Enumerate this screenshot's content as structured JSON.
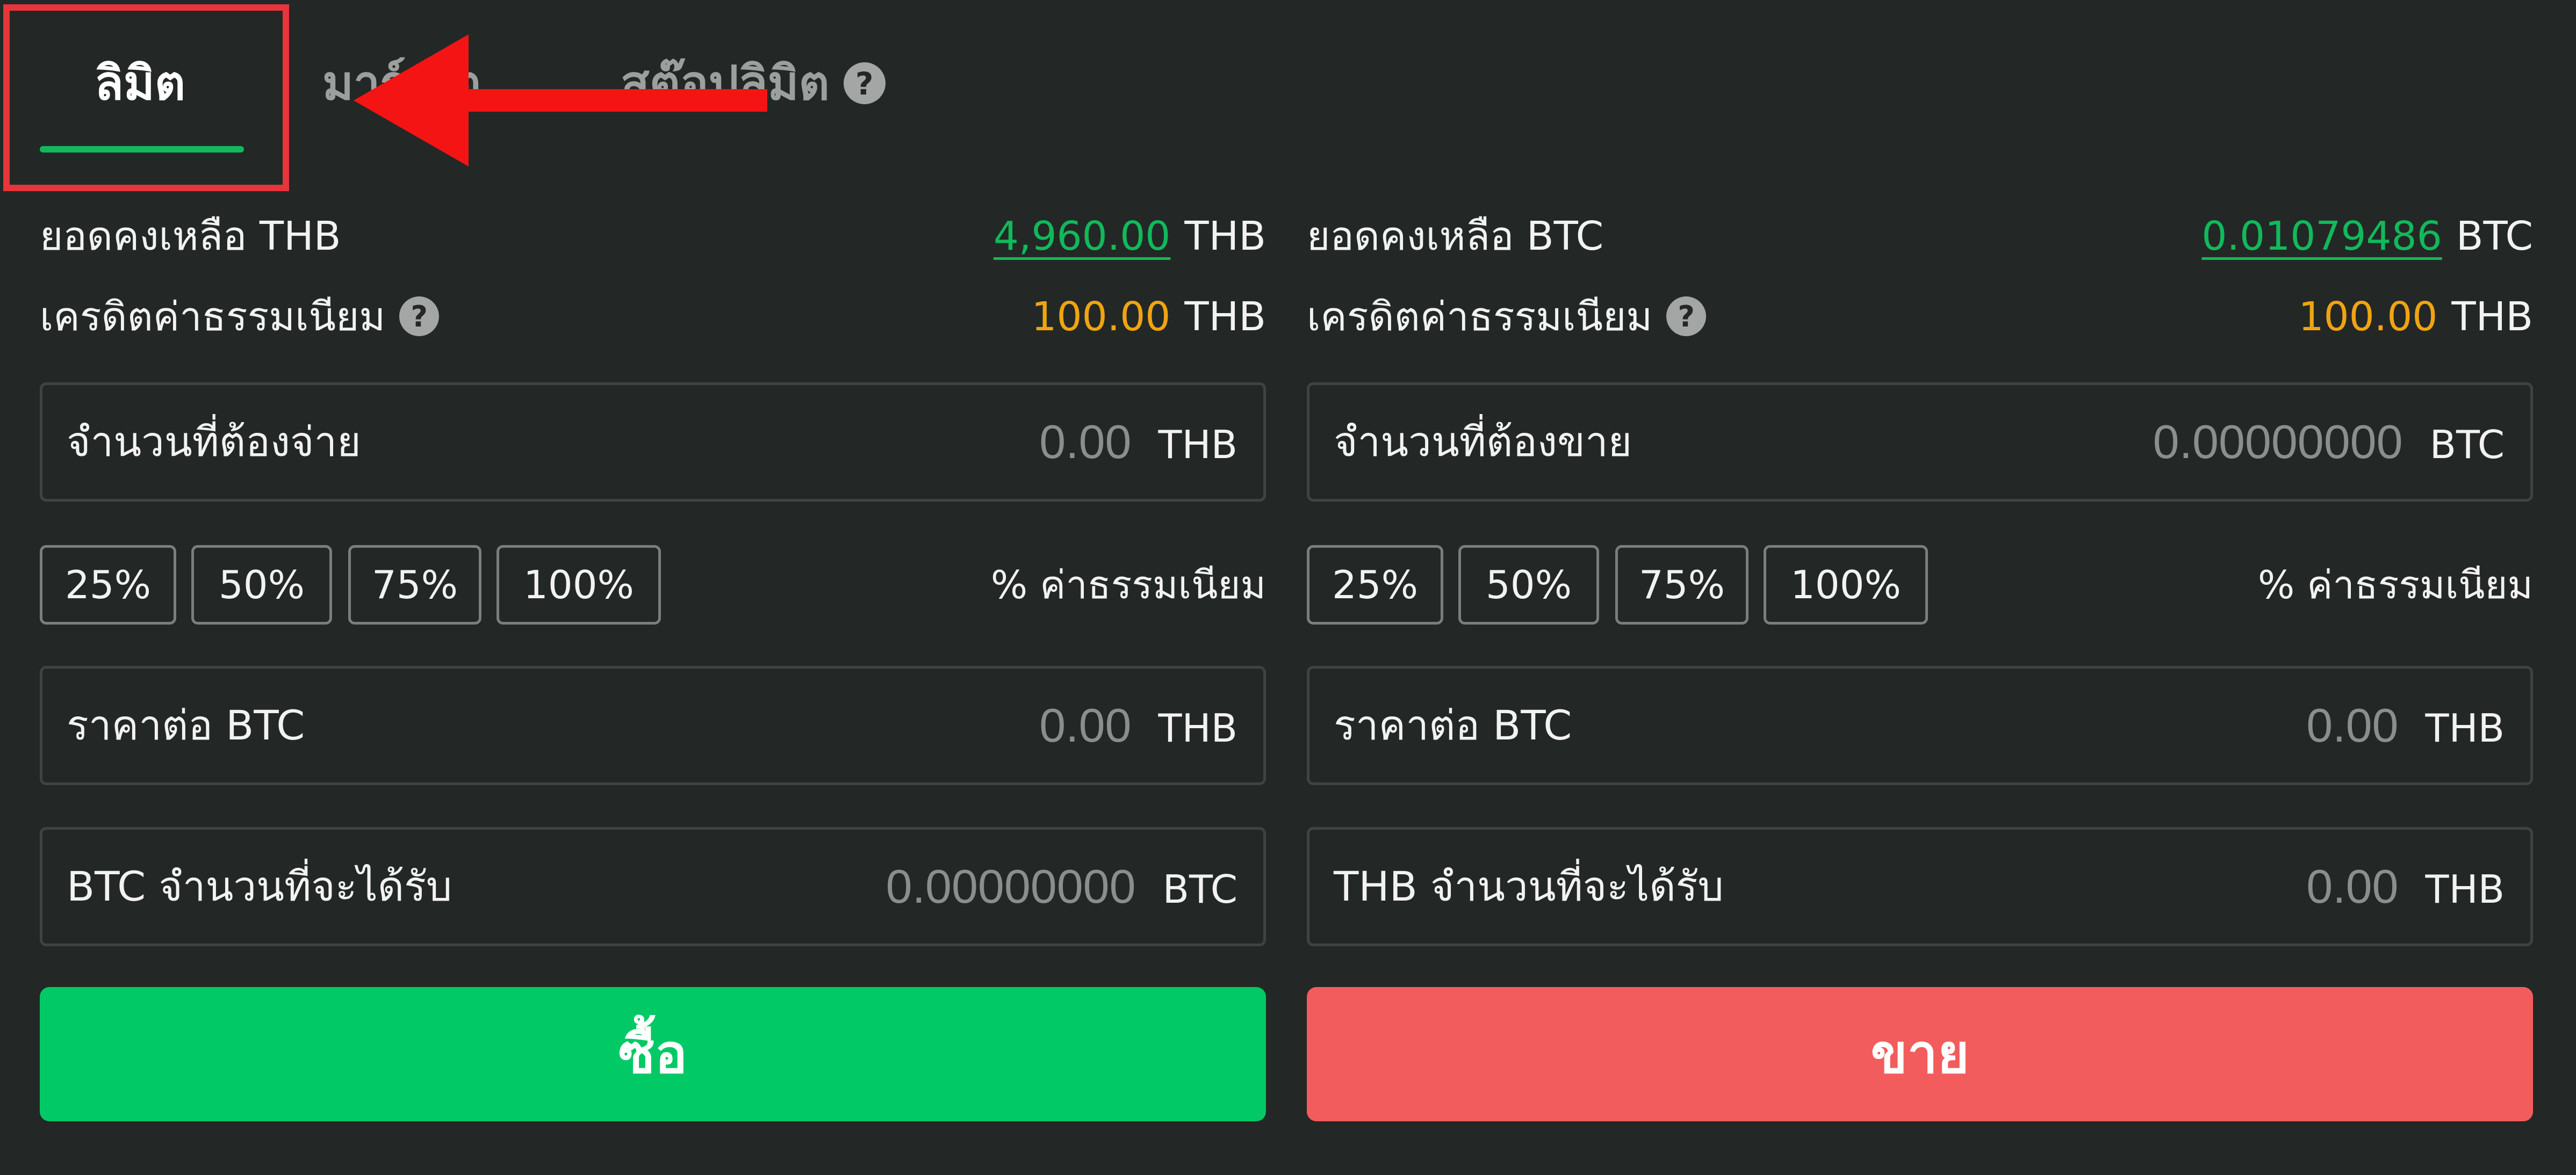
{
  "tabs": [
    {
      "label": "ลิมิต"
    },
    {
      "label": "มาร์เก็ต"
    },
    {
      "label": "สต๊อปลิมิต"
    }
  ],
  "help_glyph": "?",
  "buy": {
    "balance_label": "ยอดคงเหลือ THB",
    "balance_value": "4,960.00",
    "balance_unit": "THB",
    "credit_label": "เครดิตค่าธรรมเนียม",
    "credit_value": "100.00",
    "credit_unit": "THB",
    "amount": {
      "label": "จำนวนที่ต้องจ่าย",
      "value": "0.00",
      "unit": "THB"
    },
    "percent_buttons": [
      "25%",
      "50%",
      "75%",
      "100%"
    ],
    "fee_label": "% ค่าธรรมเนียม",
    "price": {
      "label": "ราคาต่อ BTC",
      "value": "0.00",
      "unit": "THB"
    },
    "receive": {
      "label": "BTC จำนวนที่จะได้รับ",
      "value": "0.00000000",
      "unit": "BTC"
    },
    "submit_label": "ซื้อ"
  },
  "sell": {
    "balance_label": "ยอดคงเหลือ BTC",
    "balance_value": "0.01079486",
    "balance_unit": "BTC",
    "credit_label": "เครดิตค่าธรรมเนียม",
    "credit_value": "100.00",
    "credit_unit": "THB",
    "amount": {
      "label": "จำนวนที่ต้องขาย",
      "value": "0.00000000",
      "unit": "BTC"
    },
    "percent_buttons": [
      "25%",
      "50%",
      "75%",
      "100%"
    ],
    "fee_label": "% ค่าธรรมเนียม",
    "price": {
      "label": "ราคาต่อ BTC",
      "value": "0.00",
      "unit": "THB"
    },
    "receive": {
      "label": "THB จำนวนที่จะได้รับ",
      "value": "0.00",
      "unit": "THB"
    },
    "submit_label": "ขาย"
  },
  "colors": {
    "background": "#232826",
    "accent_green": "#00c965",
    "sell_red": "#f35c5d",
    "credit_orange": "#f0a411",
    "annotation_red": "#e6353b"
  },
  "annotation_arrow_icon": "left-arrow-icon"
}
